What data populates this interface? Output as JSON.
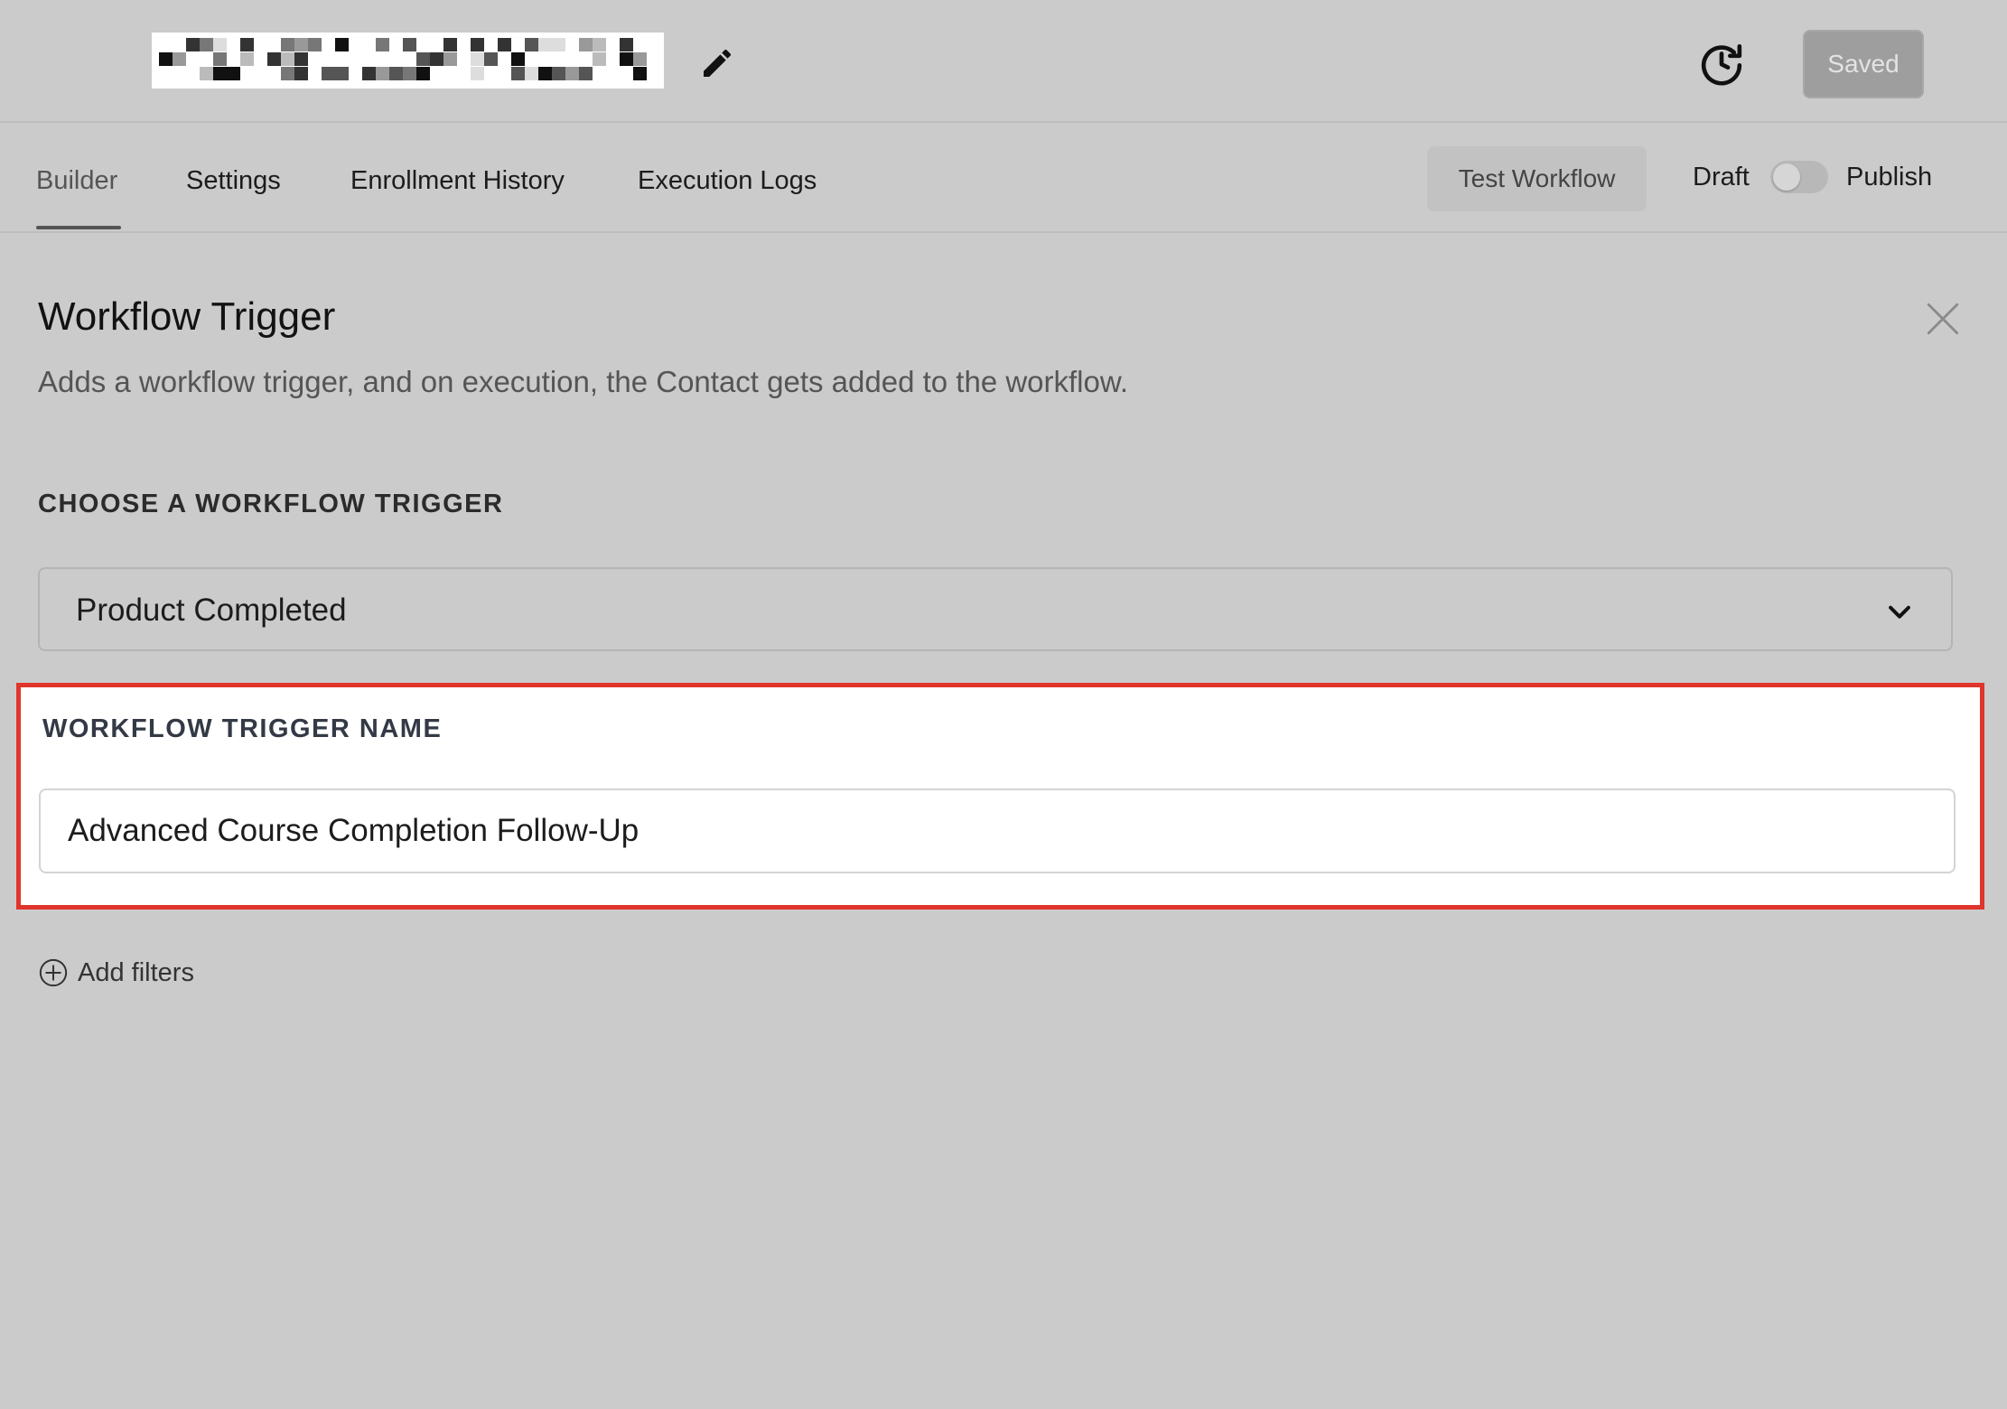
{
  "header": {
    "workflow_title": "",
    "saved_label": "Saved"
  },
  "tabs": [
    {
      "label": "Builder",
      "active": true
    },
    {
      "label": "Settings",
      "active": false
    },
    {
      "label": "Enrollment History",
      "active": false
    },
    {
      "label": "Execution Logs",
      "active": false
    }
  ],
  "actions": {
    "test_workflow_label": "Test Workflow",
    "draft_label": "Draft",
    "publish_label": "Publish",
    "published": false
  },
  "panel": {
    "title": "Workflow Trigger",
    "description": "Adds a workflow trigger, and on execution, the Contact gets added to the workflow.",
    "choose_trigger_label": "CHOOSE A WORKFLOW TRIGGER",
    "selected_trigger": "Product Completed",
    "trigger_name_label": "WORKFLOW TRIGGER NAME",
    "trigger_name_value": "Advanced Course Completion Follow-Up",
    "add_filters_label": "Add filters"
  },
  "icons": {
    "edit": "pencil-icon",
    "history": "history-clock-icon",
    "close": "close-icon",
    "select": "chevron-down-icon",
    "add": "plus-circle-icon"
  },
  "colors": {
    "background": "#cbcbcb",
    "highlight_border": "#e0352b",
    "saved_button": "#9e9e9e"
  }
}
